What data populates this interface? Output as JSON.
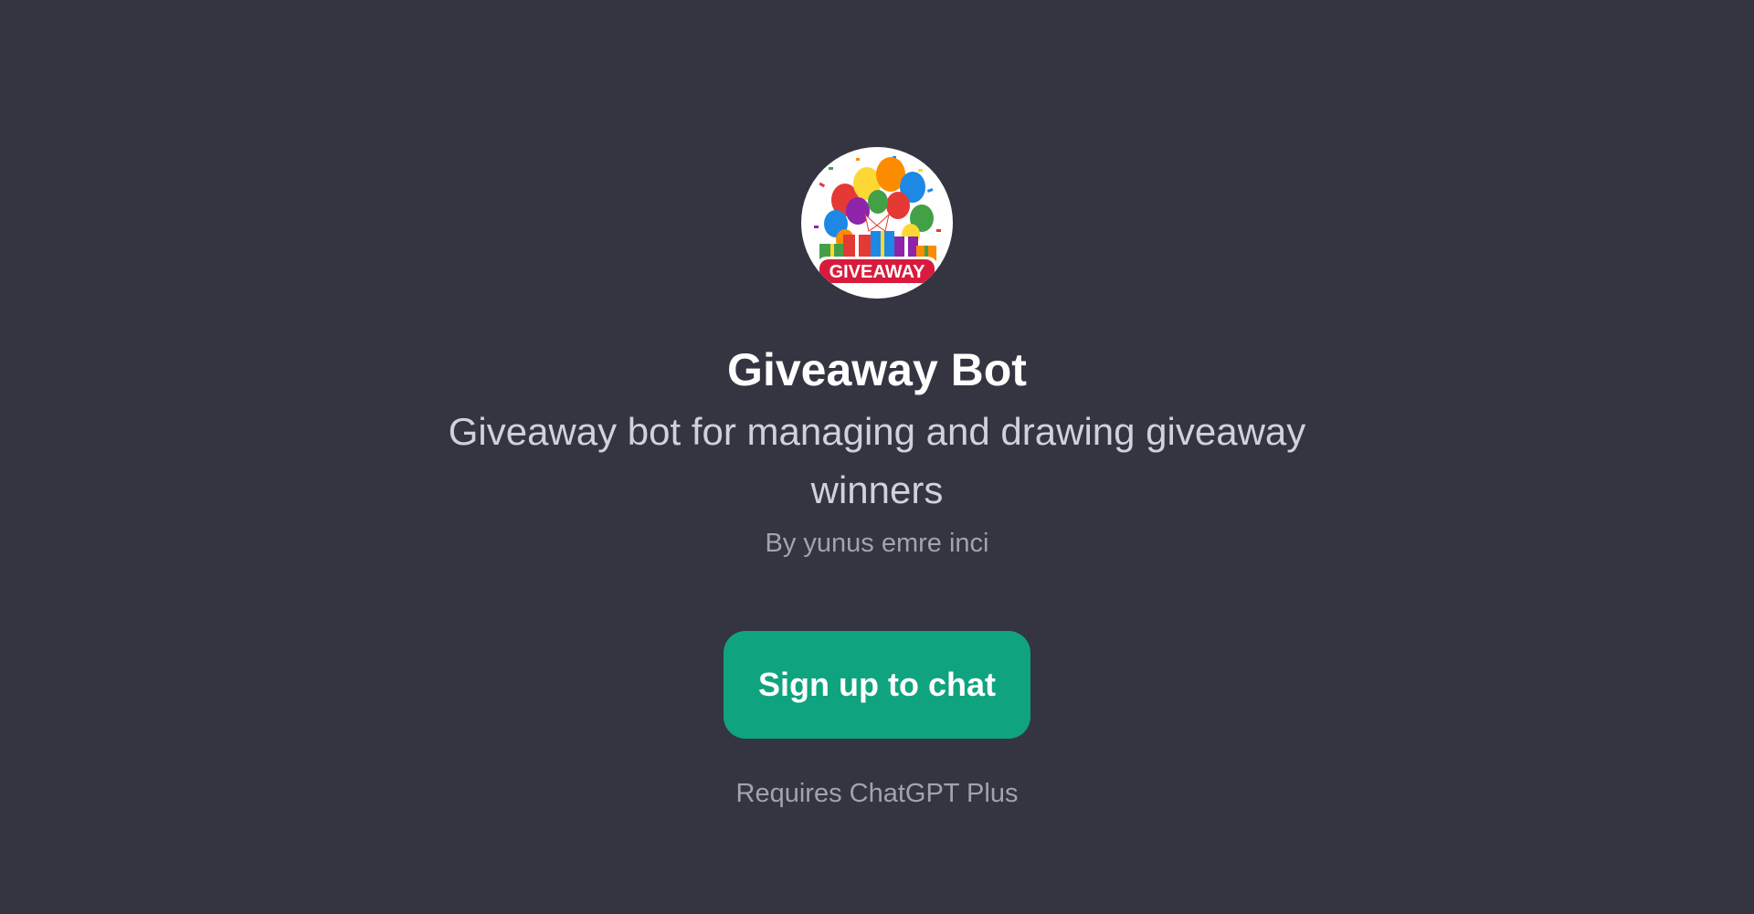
{
  "profile": {
    "logo_text": "GIVEAWAY",
    "title": "Giveaway Bot",
    "description": "Giveaway bot for managing and drawing giveaway winners",
    "author": "By yunus emre inci"
  },
  "actions": {
    "signup_label": "Sign up to chat",
    "requirement": "Requires ChatGPT Plus"
  },
  "colors": {
    "background": "#343541",
    "button": "#10a37f",
    "title": "#ffffff",
    "subtitle": "#d1d1db",
    "muted": "#a3a3ad"
  },
  "icons": {
    "avatar": "giveaway-logo-icon"
  }
}
